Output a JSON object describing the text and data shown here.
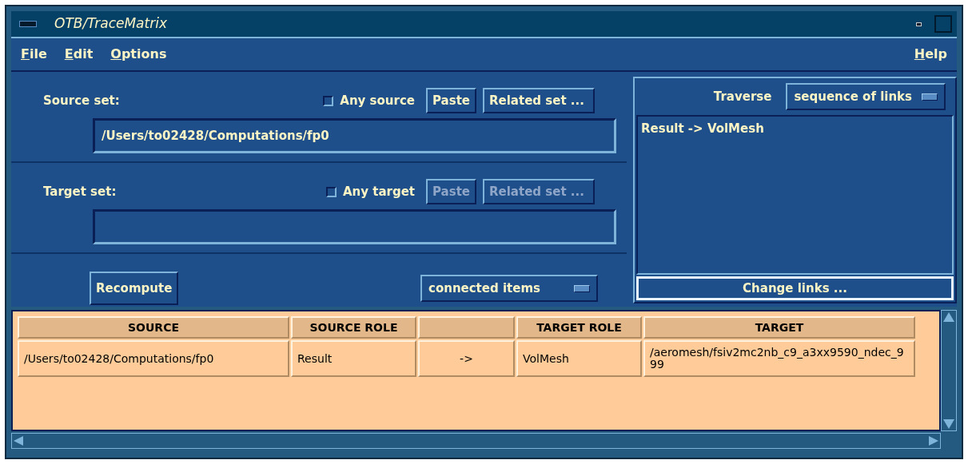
{
  "window": {
    "title": "OTB/TraceMatrix"
  },
  "menu": [
    {
      "underlined": "F",
      "rest": "ile"
    },
    {
      "underlined": "E",
      "rest": "dit"
    },
    {
      "underlined": "O",
      "rest": "ptions"
    }
  ],
  "help_menu": {
    "underlined": "H",
    "rest": "elp"
  },
  "source_set": {
    "label": "Source set:",
    "any_label": "Any source",
    "any_checked": false,
    "paste": "Paste",
    "related": "Related set ...",
    "disabled": false,
    "value": "/Users/to02428/Computations/fp0"
  },
  "target_set": {
    "label": "Target set:",
    "any_label": "Any target",
    "any_checked": false,
    "paste": "Paste",
    "related": "Related set ...",
    "disabled": true
  },
  "recompute": "Recompute",
  "mode_menu": "connected items",
  "traverse": {
    "label": "Traverse",
    "option": "sequence of links",
    "links": [
      "Result -> VolMesh"
    ],
    "change_button": "Change links ..."
  },
  "table": {
    "columns": [
      "SOURCE",
      "SOURCE ROLE",
      "",
      "TARGET ROLE",
      "TARGET"
    ],
    "rows": [
      [
        "/Users/to02428/Computations/fp0",
        "Result",
        "->",
        "VolMesh",
        "/aeromesh/fsiv2mc2nb_c9_a3xx9590_ndec_999"
      ]
    ]
  }
}
